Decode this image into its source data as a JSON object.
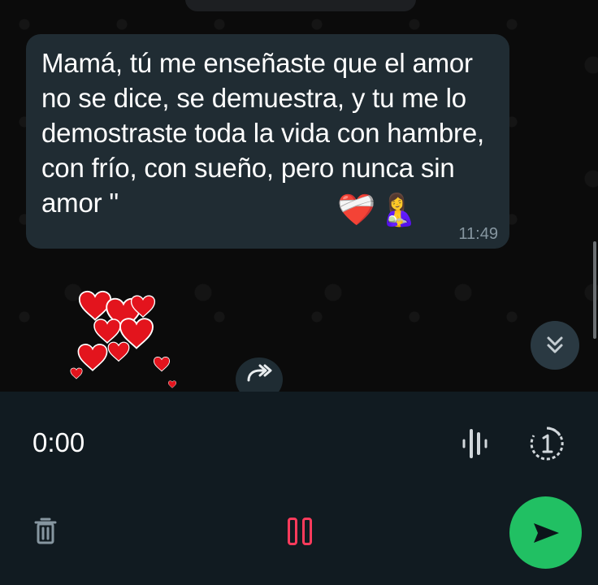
{
  "message": {
    "text": "Mamá, tú me enseñaste que el amor no se dice, se demuestra, y tu me lo demostraste toda la vida con hambre, con frío, con sueño, pero nunca sin amor \"",
    "emoji_heart": "❤️‍🩹",
    "emoji_mother": "🤱",
    "time": "11:49"
  },
  "recorder": {
    "timer": "0:00"
  },
  "icons": {
    "scroll_down": "double-chevron-down-icon",
    "forward": "forward-arrow-icon",
    "waveform": "waveform-icon",
    "view_once": "view-once-icon",
    "delete": "trash-icon",
    "pause": "pause-icon",
    "send": "send-icon"
  },
  "colors": {
    "bubble": "#202c33",
    "recorder_bg": "#111b21",
    "send_button": "#21c063",
    "pause_red": "#ff3b5c",
    "heart_red": "#e3141d"
  }
}
